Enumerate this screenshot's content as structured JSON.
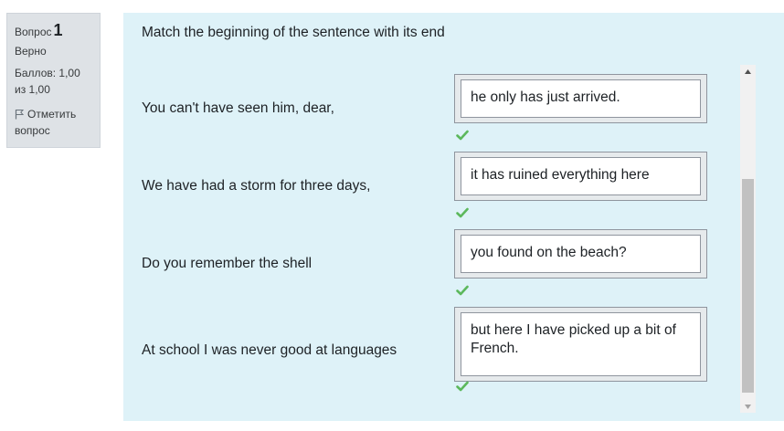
{
  "question_info": {
    "label": "Вопрос",
    "number": "1",
    "state": "Верно",
    "grade": "Баллов: 1,00 из 1,00",
    "flag_label": "Отметить вопрос"
  },
  "question": {
    "prompt": "Match the beginning of the sentence with its end",
    "rows": [
      {
        "beginning": "You can't have seen him, dear,",
        "answer": "he only has just arrived.",
        "correct": true
      },
      {
        "beginning": "We have had a storm for three days,",
        "answer": "it has ruined everything here",
        "correct": true
      },
      {
        "beginning": "Do you remember the shell",
        "answer": "you found on the beach?",
        "correct": true
      },
      {
        "beginning": "At school I was never good at languages",
        "answer": "but here I have picked up a bit of French.",
        "correct": true
      }
    ]
  },
  "colors": {
    "content_bg": "#def2f8",
    "info_bg": "#dee2e6",
    "check": "#5cb85c"
  },
  "icons": {
    "flag": "flag-icon",
    "check": "check-icon",
    "scroll_up": "scroll-up-arrow-icon",
    "scroll_down": "scroll-down-arrow-icon"
  }
}
